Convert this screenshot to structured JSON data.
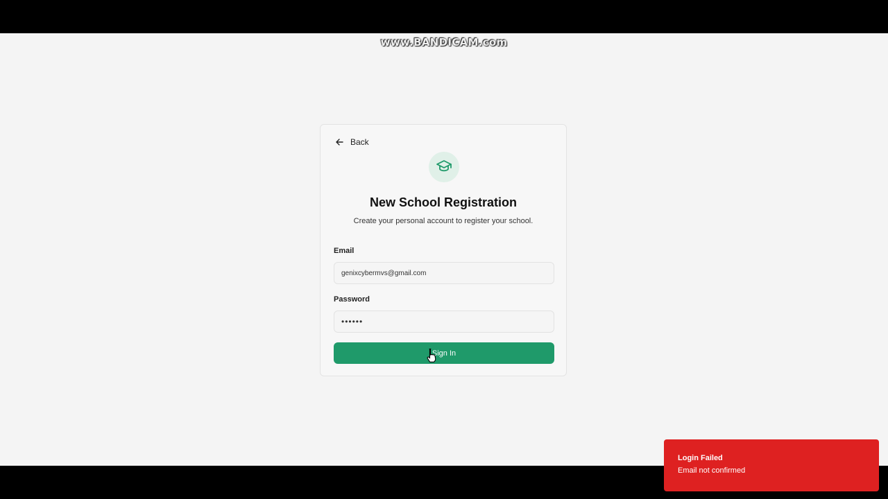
{
  "watermark": "www.BANDICAM.com",
  "card": {
    "back_label": "Back",
    "logo_icon": "graduation-cap-icon",
    "title": "New School Registration",
    "subtitle": "Create your personal account to register your school.",
    "email": {
      "label": "Email",
      "value": "genixcybermvs@gmail.com"
    },
    "password": {
      "label": "Password",
      "value": "••••••"
    },
    "signin_label": "Sign In"
  },
  "toast": {
    "title": "Login Failed",
    "message": "Email not confirmed"
  },
  "colors": {
    "accent": "#1f9a6a",
    "error": "#de2121",
    "background": "#f4f4f4"
  }
}
